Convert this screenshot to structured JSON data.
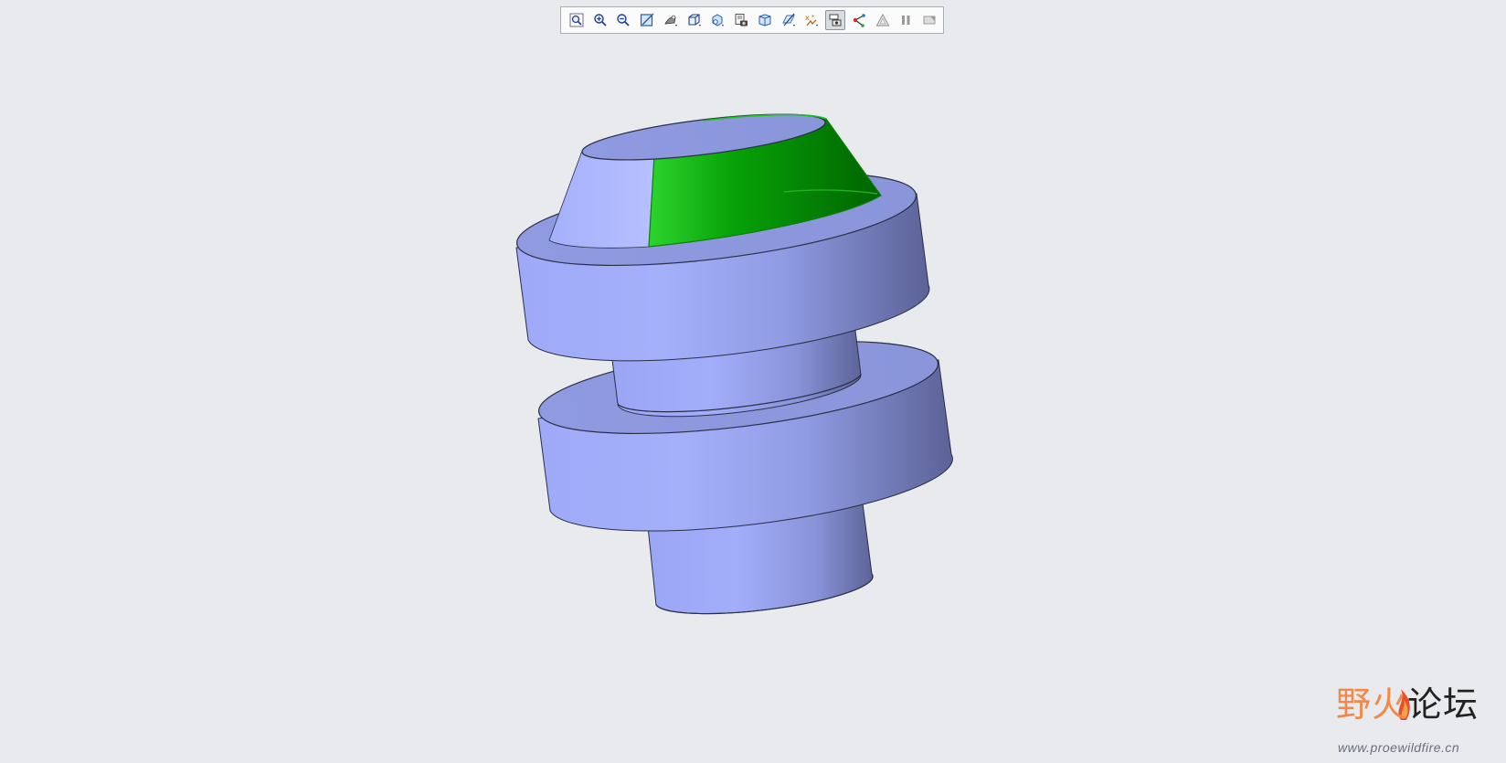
{
  "app": {
    "name": "Creo Parametric graphics window"
  },
  "toolbar": {
    "buttons": [
      {
        "name": "refit-button",
        "icon": "zoom-fit-icon"
      },
      {
        "name": "zoom-in-button",
        "icon": "zoom-in-icon"
      },
      {
        "name": "zoom-out-button",
        "icon": "zoom-out-icon"
      },
      {
        "name": "repaint-button",
        "icon": "repaint-icon"
      },
      {
        "name": "display-style-button",
        "icon": "shading-icon"
      },
      {
        "name": "saved-orientations-button",
        "icon": "cube-orientation-icon"
      },
      {
        "name": "view-manager-button",
        "icon": "view-manager-icon"
      },
      {
        "name": "appearance-button",
        "icon": "camera-icon"
      },
      {
        "name": "perspective-button",
        "icon": "perspective-cube-icon"
      },
      {
        "name": "datum-display-button",
        "icon": "datum-plane-icon"
      },
      {
        "name": "annotation-display-button",
        "icon": "annotation-icon"
      },
      {
        "name": "select-mode-button",
        "icon": "selection-icon",
        "active": true
      },
      {
        "name": "spin-center-button",
        "icon": "spin-center-icon"
      },
      {
        "name": "simplify-button",
        "icon": "triangle-icon"
      },
      {
        "name": "pause-button",
        "icon": "pause-icon"
      },
      {
        "name": "flag-button",
        "icon": "flag-icon"
      }
    ]
  },
  "colors": {
    "background": "#e8eaee",
    "part_shade": "#9aa6f6",
    "selected_surface": "#1fa81f",
    "edge": "#2a2f45"
  },
  "watermark": {
    "cn_wild": "野火",
    "cn_forum": "论坛",
    "url": "www.proewildfire.cn"
  }
}
